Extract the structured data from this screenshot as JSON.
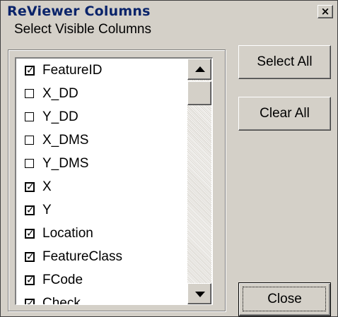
{
  "window": {
    "title": "ReViewer Columns",
    "close_glyph": "×"
  },
  "group": {
    "label": "Select Visible Columns"
  },
  "columns": [
    {
      "label": "FeatureID",
      "checked": true
    },
    {
      "label": "X_DD",
      "checked": false
    },
    {
      "label": "Y_DD",
      "checked": false
    },
    {
      "label": "X_DMS",
      "checked": false
    },
    {
      "label": "Y_DMS",
      "checked": false
    },
    {
      "label": "X",
      "checked": true
    },
    {
      "label": "Y",
      "checked": true
    },
    {
      "label": "Location",
      "checked": true
    },
    {
      "label": "FeatureClass",
      "checked": true
    },
    {
      "label": "FCode",
      "checked": true
    },
    {
      "label": "Check",
      "checked": true
    }
  ],
  "buttons": {
    "select_all": "Select All",
    "clear_all": "Clear All",
    "close": "Close"
  },
  "icons": {
    "check_glyph": "✓",
    "close_icon": "close-icon",
    "scroll_up_icon": "triangle-up-icon",
    "scroll_down_icon": "triangle-down-icon"
  },
  "colors": {
    "title_text": "#0a246a",
    "face": "#d4d0c8"
  }
}
